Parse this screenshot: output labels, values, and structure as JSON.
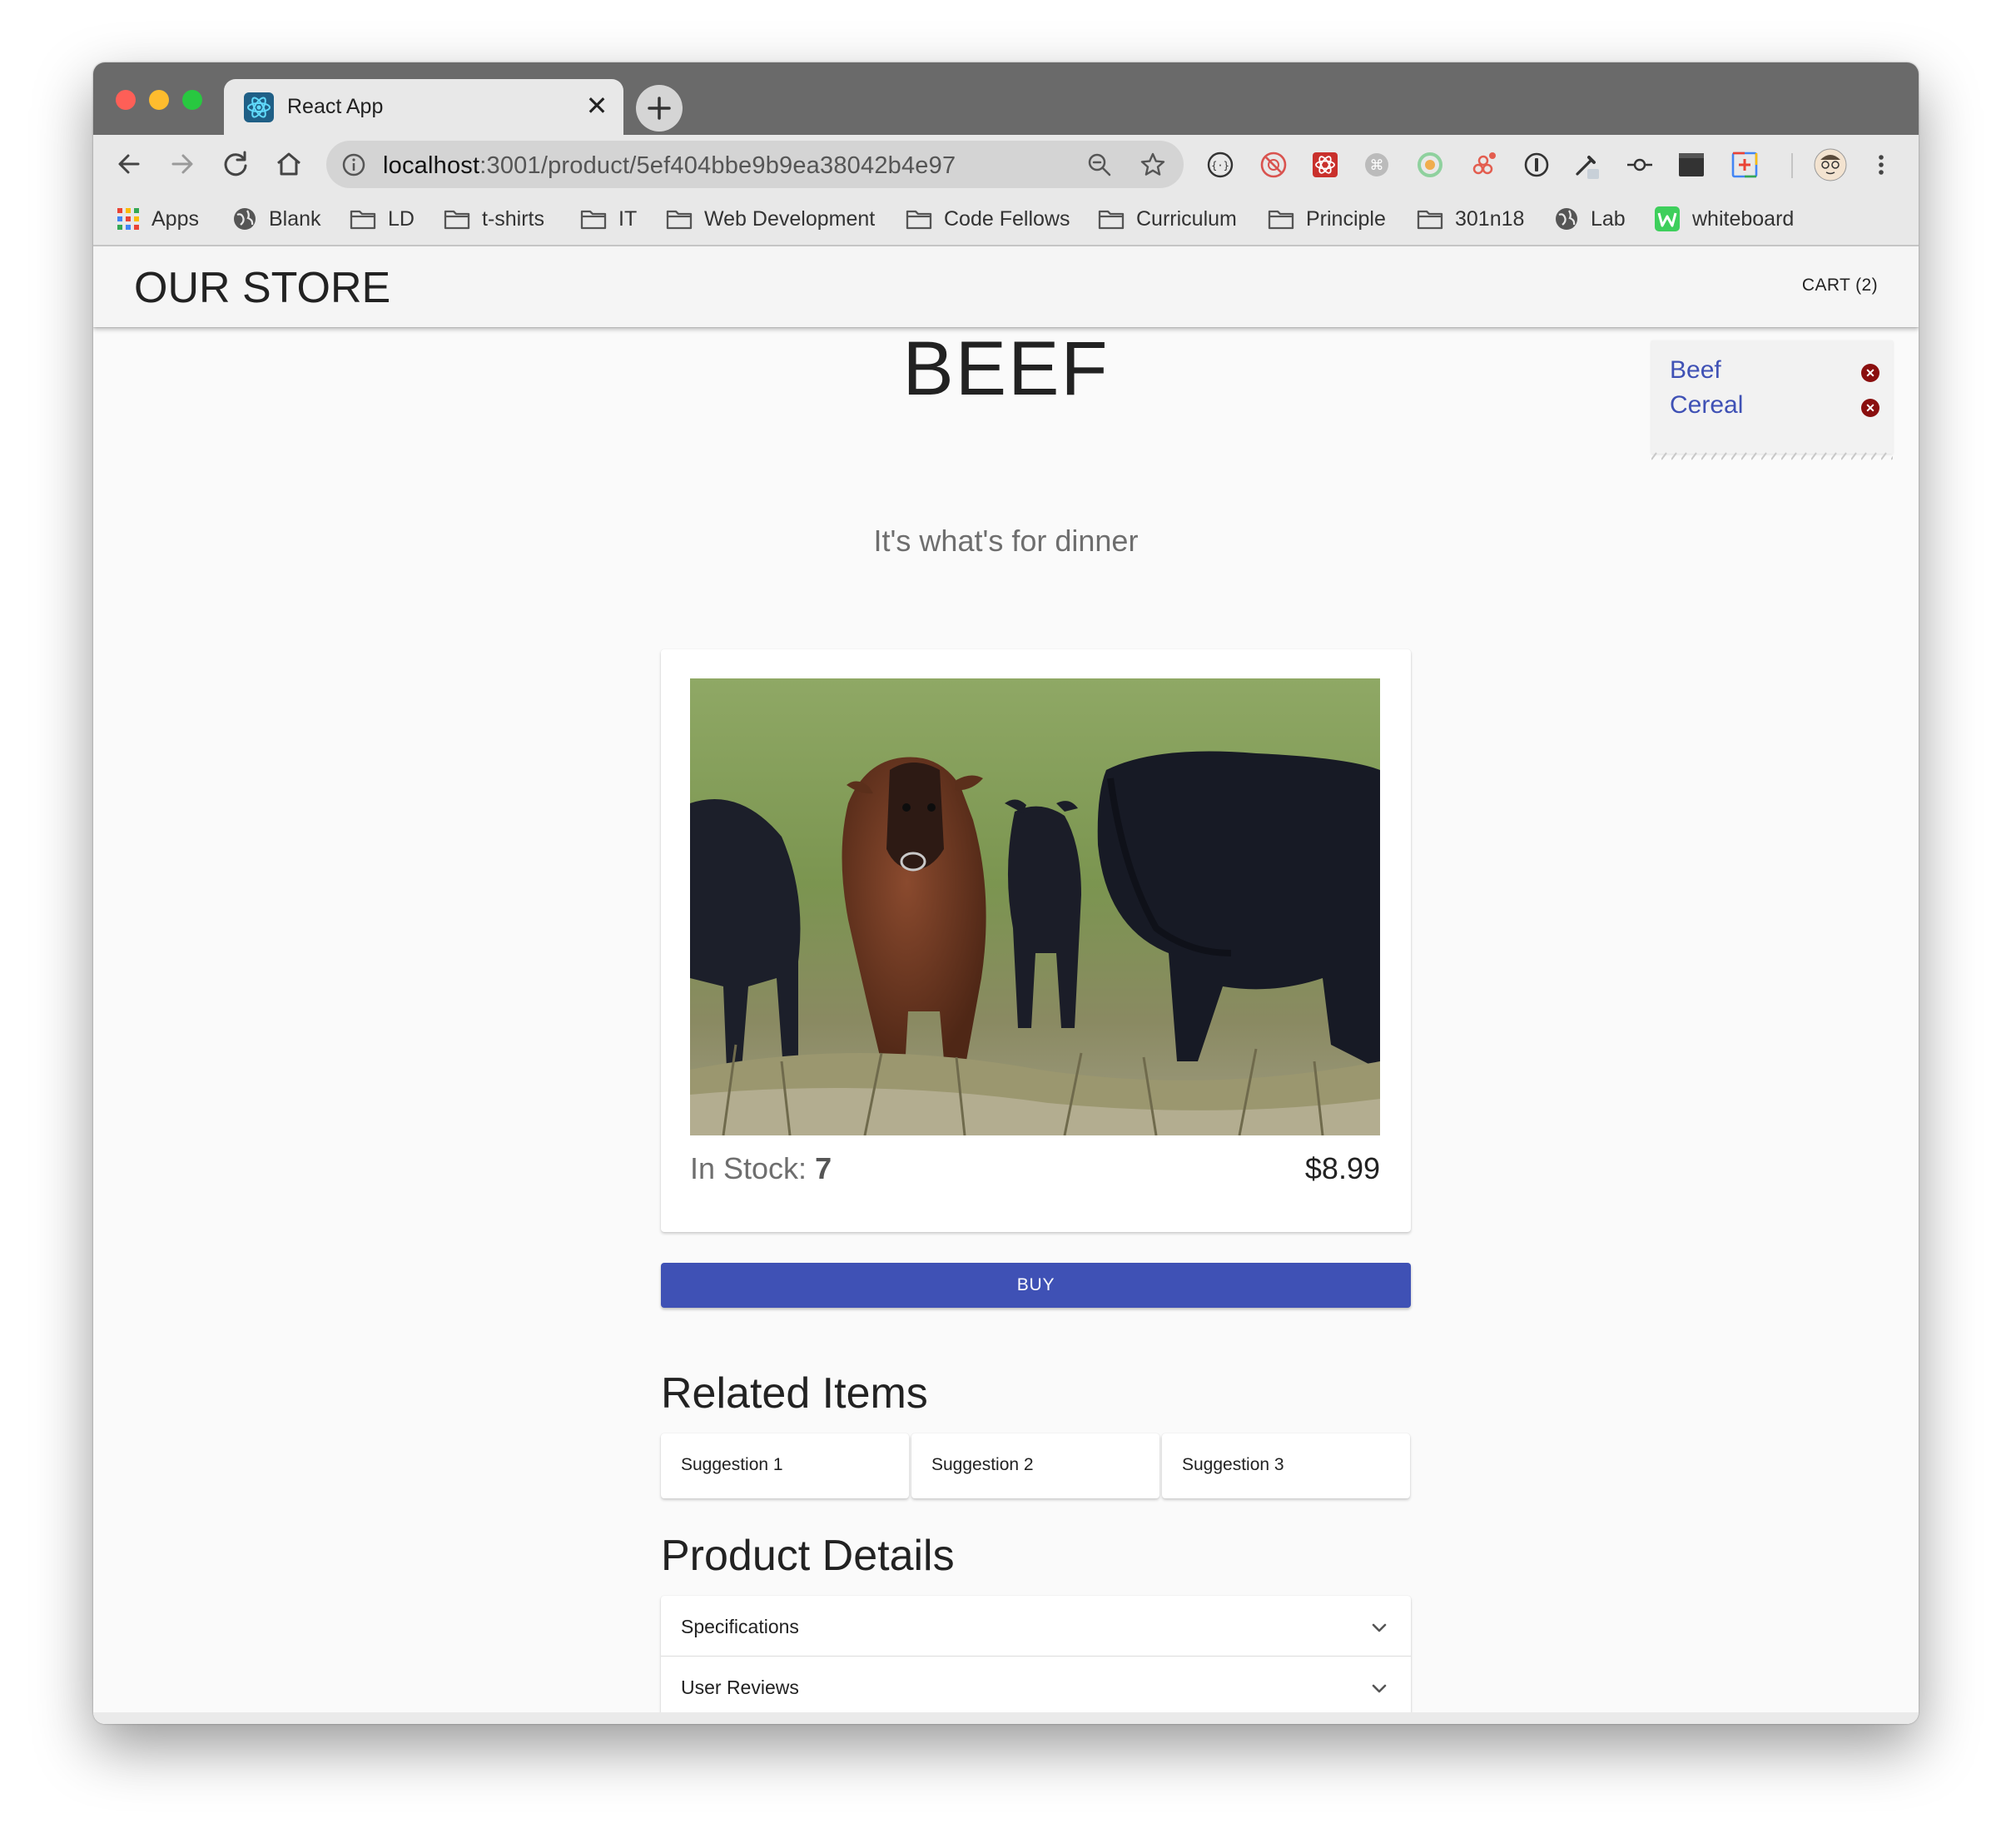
{
  "browser": {
    "tab_title": "React App",
    "tab_close": "✕",
    "new_tab": "+",
    "url_host": "localhost",
    "url_path": ":3001/product/5ef404bbe9b9ea38042b4e97",
    "bookmarks": [
      {
        "label": "Apps",
        "icon": "apps-grid-icon"
      },
      {
        "label": "Blank",
        "icon": "globe-icon"
      },
      {
        "label": "LD",
        "icon": "folder-icon"
      },
      {
        "label": "t-shirts",
        "icon": "folder-icon"
      },
      {
        "label": "IT",
        "icon": "folder-icon"
      },
      {
        "label": "Web Development",
        "icon": "folder-icon"
      },
      {
        "label": "Code Fellows",
        "icon": "folder-icon"
      },
      {
        "label": "Curriculum",
        "icon": "folder-icon"
      },
      {
        "label": "Principle",
        "icon": "folder-icon"
      },
      {
        "label": "301n18",
        "icon": "folder-icon"
      },
      {
        "label": "Lab",
        "icon": "globe-icon"
      },
      {
        "label": "whiteboard",
        "icon": "whiteboard-w-icon"
      }
    ]
  },
  "app": {
    "store_title": "OUR STORE",
    "cart_link": "CART (2)",
    "cart_items": [
      {
        "name": "Beef",
        "remove": "✕"
      },
      {
        "name": "Cereal",
        "remove": "✕"
      }
    ]
  },
  "product": {
    "name": "BEEF",
    "tagline": "It's what's for dinner",
    "stock_label": "In Stock:",
    "stock_count": "7",
    "price": "$8.99",
    "buy_label": "BUY"
  },
  "related": {
    "title": "Related Items",
    "items": [
      "Suggestion 1",
      "Suggestion 2",
      "Suggestion 3"
    ]
  },
  "details": {
    "title": "Product Details",
    "panels": [
      "Specifications",
      "User Reviews"
    ]
  },
  "colors": {
    "primary": "#3f51b5",
    "remove_badge": "#8a0f0f"
  }
}
